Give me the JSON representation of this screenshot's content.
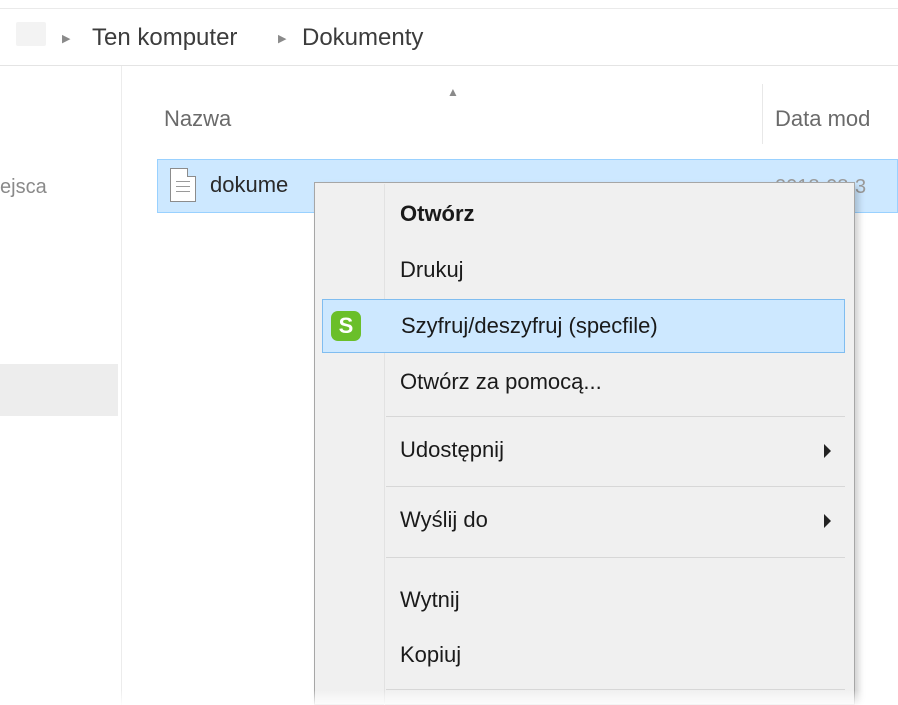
{
  "breadcrumb": {
    "items": [
      "Ten komputer",
      "Dokumenty"
    ]
  },
  "navigation": {
    "partial_label": "ejsca"
  },
  "columns": {
    "name": "Nazwa",
    "date": "Data mod"
  },
  "file": {
    "name": "dokume",
    "date_fragment": "2018-08-3"
  },
  "context_menu": {
    "items": [
      {
        "label": "Otwórz",
        "bold": true
      },
      {
        "label": "Drukuj"
      },
      {
        "label": "Szyfruj/deszyfruj (specfile)",
        "icon": "specfile-s-icon",
        "icon_letter": "S",
        "highlighted": true
      },
      {
        "label": "Otwórz za pomocą..."
      },
      {
        "label": "Udostępnij",
        "submenu": true
      },
      {
        "label": "Wyślij do",
        "submenu": true
      },
      {
        "label": "Wytnij"
      },
      {
        "label": "Kopiuj"
      }
    ]
  },
  "colors": {
    "selection_bg": "#cde8ff",
    "selection_border": "#99d1ff",
    "menu_bg": "#f0f0f0",
    "app_icon": "#6abf2a"
  }
}
